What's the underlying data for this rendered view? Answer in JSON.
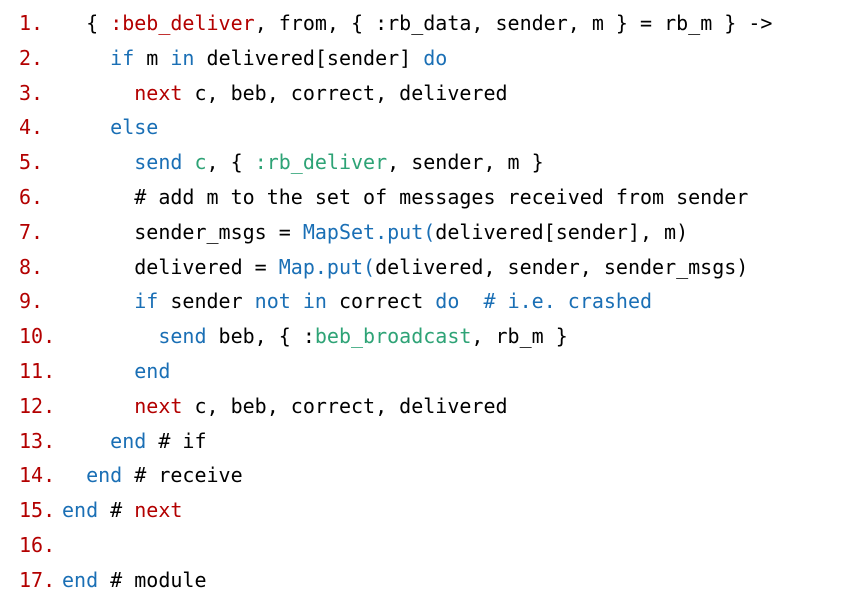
{
  "colors": {
    "line_number": "#b30000",
    "keyword": "#1a6fb5",
    "atom": "#2ea376",
    "default": "#000000"
  },
  "lines": [
    {
      "num": "1.",
      "indent": "  ",
      "tokens": [
        {
          "t": "{ ",
          "c": "black"
        },
        {
          "t": ":beb_deliver",
          "c": "red"
        },
        {
          "t": ", from, { :rb_data, sender, m } = rb_m } ->",
          "c": "black"
        }
      ]
    },
    {
      "num": "2.",
      "indent": "    ",
      "tokens": [
        {
          "t": "if",
          "c": "blue"
        },
        {
          "t": " m ",
          "c": "black"
        },
        {
          "t": "in",
          "c": "blue"
        },
        {
          "t": " delivered[sender] ",
          "c": "black"
        },
        {
          "t": "do",
          "c": "blue"
        }
      ]
    },
    {
      "num": "3.",
      "indent": "      ",
      "tokens": [
        {
          "t": "next",
          "c": "red"
        },
        {
          "t": " c, beb, correct, delivered",
          "c": "black"
        }
      ]
    },
    {
      "num": "4.",
      "indent": "    ",
      "tokens": [
        {
          "t": "else",
          "c": "blue"
        }
      ]
    },
    {
      "num": "5.",
      "indent": "      ",
      "tokens": [
        {
          "t": "send",
          "c": "blue"
        },
        {
          "t": " ",
          "c": "black"
        },
        {
          "t": "c",
          "c": "green"
        },
        {
          "t": ", { ",
          "c": "black"
        },
        {
          "t": ":rb_deliver",
          "c": "green"
        },
        {
          "t": ", sender, m }",
          "c": "black"
        }
      ]
    },
    {
      "num": "6.",
      "indent": "      ",
      "tokens": [
        {
          "t": "# add m to the set of messages received from sender",
          "c": "black"
        }
      ]
    },
    {
      "num": "7.",
      "indent": "      ",
      "tokens": [
        {
          "t": "sender_msgs = ",
          "c": "black"
        },
        {
          "t": "MapSet.put(",
          "c": "blue"
        },
        {
          "t": "delivered[sender], m)",
          "c": "black"
        }
      ]
    },
    {
      "num": "8.",
      "indent": "      ",
      "tokens": [
        {
          "t": "delivered = ",
          "c": "black"
        },
        {
          "t": "Map.put(",
          "c": "blue"
        },
        {
          "t": "delivered, sender, sender_msgs)",
          "c": "black"
        }
      ]
    },
    {
      "num": "9.",
      "indent": "      ",
      "tokens": [
        {
          "t": "if",
          "c": "blue"
        },
        {
          "t": " sender ",
          "c": "black"
        },
        {
          "t": "not in",
          "c": "blue"
        },
        {
          "t": " correct ",
          "c": "black"
        },
        {
          "t": "do",
          "c": "blue"
        },
        {
          "t": "  ",
          "c": "black"
        },
        {
          "t": "# i.e. crashed",
          "c": "blue"
        }
      ]
    },
    {
      "num": "10.",
      "indent": "        ",
      "tokens": [
        {
          "t": "send",
          "c": "blue"
        },
        {
          "t": " beb, { :",
          "c": "black"
        },
        {
          "t": "beb_broadcast",
          "c": "green"
        },
        {
          "t": ", rb_m }",
          "c": "black"
        }
      ]
    },
    {
      "num": "11.",
      "indent": "      ",
      "tokens": [
        {
          "t": "end",
          "c": "blue"
        }
      ]
    },
    {
      "num": "12.",
      "indent": "      ",
      "tokens": [
        {
          "t": "next",
          "c": "red"
        },
        {
          "t": " c, beb, correct, delivered",
          "c": "black"
        }
      ]
    },
    {
      "num": "13.",
      "indent": "    ",
      "tokens": [
        {
          "t": "end",
          "c": "blue"
        },
        {
          "t": " # if",
          "c": "black"
        }
      ]
    },
    {
      "num": "14.",
      "indent": "  ",
      "tokens": [
        {
          "t": "end",
          "c": "blue"
        },
        {
          "t": " # receive",
          "c": "black"
        }
      ]
    },
    {
      "num": "15.",
      "indent": "",
      "tokens": [
        {
          "t": "end",
          "c": "blue"
        },
        {
          "t": " # ",
          "c": "black"
        },
        {
          "t": "next",
          "c": "red"
        }
      ]
    },
    {
      "num": "16.",
      "indent": "",
      "tokens": []
    },
    {
      "num": "17.",
      "indent": "",
      "tokens": [
        {
          "t": "end",
          "c": "blue"
        },
        {
          "t": " # module",
          "c": "black"
        }
      ]
    }
  ]
}
